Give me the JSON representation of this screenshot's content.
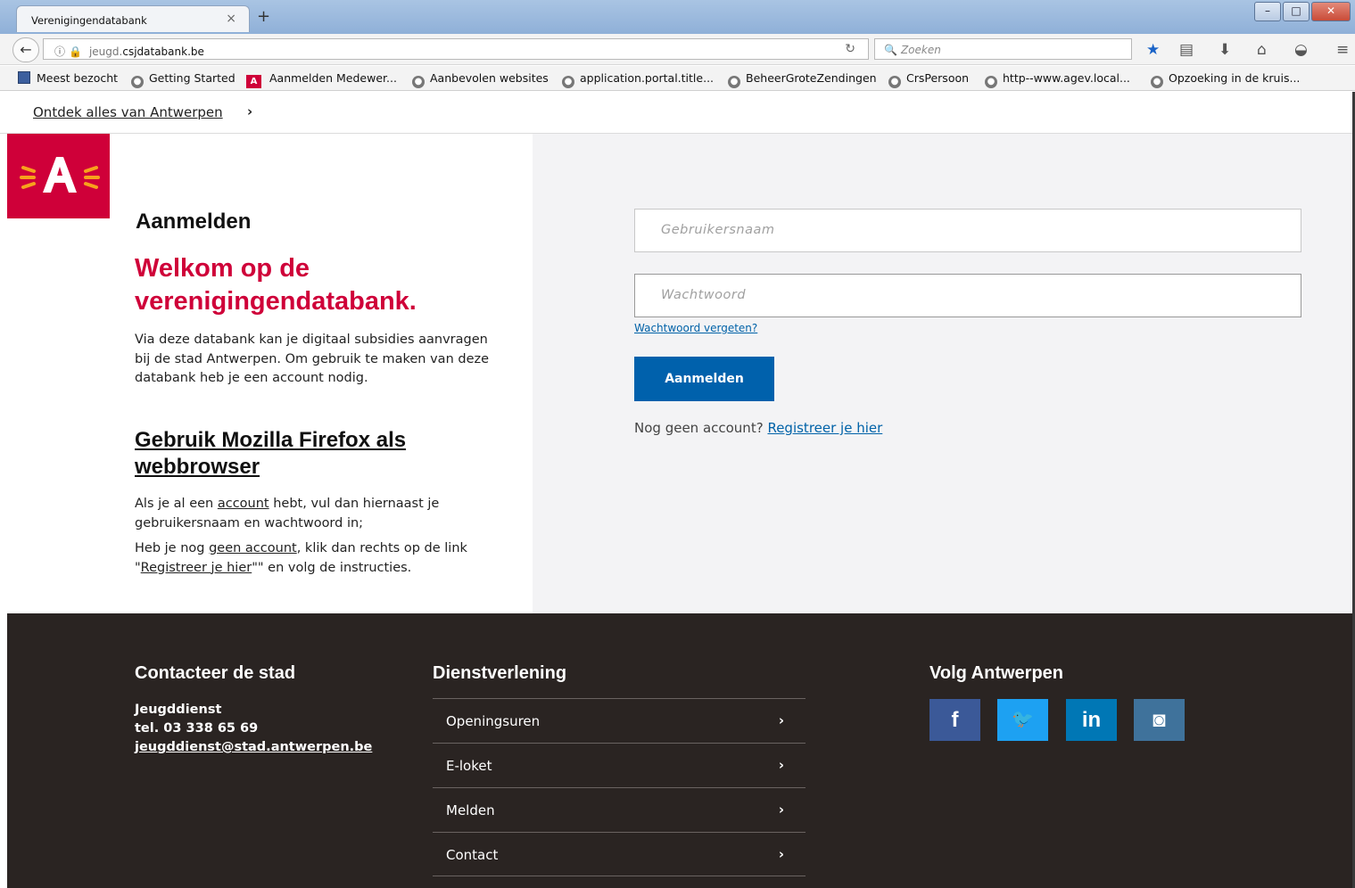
{
  "browser": {
    "tab_title": "Verenigingendatabank",
    "tab_close": "×",
    "new_tab": "+",
    "url_host": "jeugd.",
    "url_domain": "csjdatabank.be",
    "search_placeholder": "Zoeken",
    "bookmarks": [
      {
        "label": "Meest bezocht",
        "icon": "folder-icon"
      },
      {
        "label": "Getting Started",
        "icon": "globe-icon"
      },
      {
        "label": "Aanmelden Medewer...",
        "icon": "antwerpen-icon"
      },
      {
        "label": "Aanbevolen websites",
        "icon": "globe-icon"
      },
      {
        "label": "application.portal.title...",
        "icon": "globe-icon"
      },
      {
        "label": "BeheerGroteZendingen",
        "icon": "globe-icon"
      },
      {
        "label": "CrsPersoon",
        "icon": "globe-icon"
      },
      {
        "label": "http--www.agev.local...",
        "icon": "globe-icon"
      },
      {
        "label": "Opzoeking in de kruis...",
        "icon": "globe-icon"
      }
    ]
  },
  "topbar": {
    "discover_link": "Ontdek alles van Antwerpen",
    "chevron": "›"
  },
  "login": {
    "heading": "Aanmelden",
    "welcome": "Welkom op de verenigingendatabank.",
    "intro": "Via deze databank kan je digitaal subsidies aanvragen bij de stad Antwerpen. Om gebruik te maken van deze databank heb je een account nodig.",
    "firefox_link": "Gebruik Mozilla Firefox als webbrowser",
    "para1_before": "Als je al een ",
    "para1_link": "account",
    "para1_after": " hebt, vul dan hiernaast je gebruikersnaam en wachtwoord in;",
    "para2_before": "Heb je nog ",
    "para2_link": "geen account",
    "para2_mid": ", klik dan rechts op de link \"",
    "para2_link2": "Registreer je hier",
    "para2_after": "\"\" en volg de instructies.",
    "username_placeholder": "Gebruikersnaam",
    "password_placeholder": "Wachtwoord",
    "forgot_link": "Wachtwoord vergeten?",
    "login_button": "Aanmelden",
    "no_account_text": "Nog geen account?",
    "register_link": "Registreer je hier"
  },
  "footer": {
    "contact_title": "Contacteer de stad",
    "contact_name": "Jeugddienst",
    "contact_phone": "tel. 03 338 65 69",
    "contact_email": "jeugddienst@stad.antwerpen.be",
    "services_title": "Dienstverlening",
    "services": [
      "Openingsuren",
      "E-loket",
      "Melden",
      "Contact"
    ],
    "follow_title": "Volg Antwerpen",
    "social": [
      {
        "name": "facebook",
        "glyph": "f",
        "color": "#3b5998"
      },
      {
        "name": "twitter",
        "glyph": "🐦",
        "color": "#1da1f2"
      },
      {
        "name": "linkedin",
        "glyph": "in",
        "color": "#0077b5"
      },
      {
        "name": "instagram",
        "glyph": "◙",
        "color": "#3f729b"
      }
    ]
  },
  "colors": {
    "brand_red": "#cf0039",
    "button_blue": "#0061ac",
    "footer_bg": "#2a2422"
  }
}
